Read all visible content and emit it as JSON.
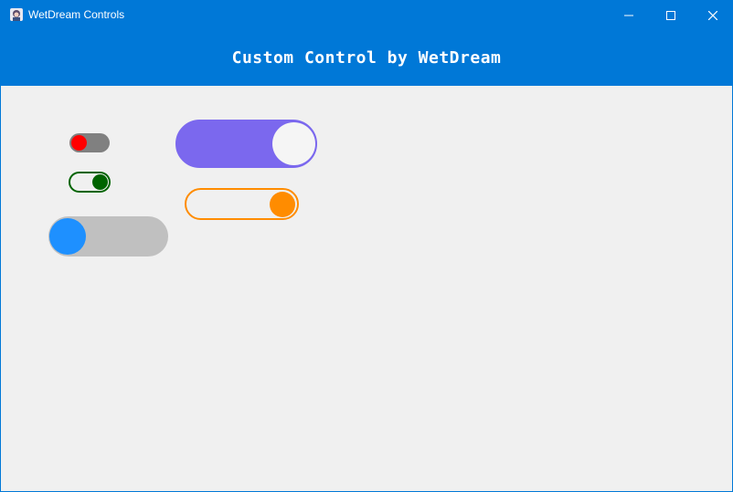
{
  "window": {
    "title": "WetDream Controls",
    "app_icon": "avatar-icon",
    "controls": [
      "minimize-icon",
      "maximize-icon",
      "close-icon"
    ]
  },
  "header": {
    "title": "Custom Control by WetDream"
  },
  "colors": {
    "titlebar": "#0078d7",
    "background": "#f0f0f0"
  },
  "toggles": [
    {
      "name": "red-toggle",
      "checked": false,
      "track_color": "#808080",
      "knob_color": "#ff0000",
      "style": "filled"
    },
    {
      "name": "green-toggle",
      "checked": true,
      "track_color": "#006400",
      "knob_color": "#006400",
      "style": "outlined"
    },
    {
      "name": "blue-toggle",
      "checked": false,
      "track_color": "#c0c0c0",
      "knob_color": "#1e90ff",
      "style": "filled"
    },
    {
      "name": "purple-toggle",
      "checked": true,
      "track_color": "#7b68ee",
      "knob_color": "#f5f5f5",
      "style": "filled"
    },
    {
      "name": "orange-toggle",
      "checked": true,
      "track_color": "#ff8c00",
      "knob_color": "#ff8c00",
      "style": "outlined"
    }
  ]
}
